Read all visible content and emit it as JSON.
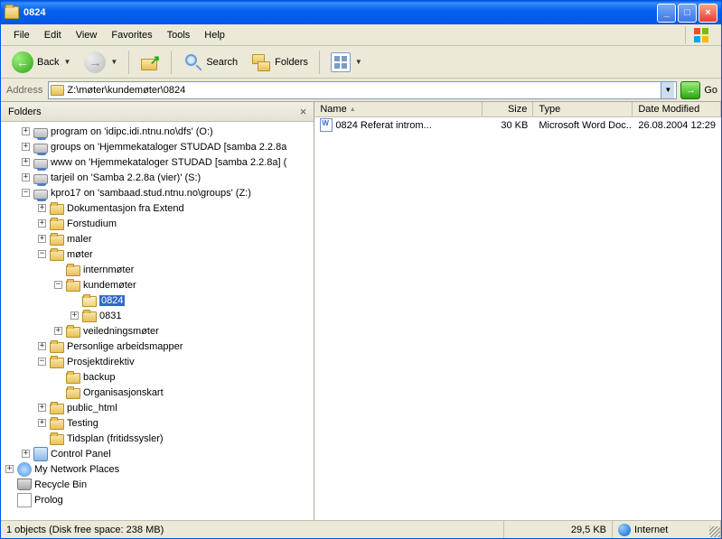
{
  "title": "0824",
  "menus": {
    "file": "File",
    "edit": "Edit",
    "view": "View",
    "favorites": "Favorites",
    "tools": "Tools",
    "help": "Help"
  },
  "toolbar": {
    "back": "Back",
    "search": "Search",
    "folders": "Folders"
  },
  "address": {
    "label": "Address",
    "value": "Z:\\møter\\kundemøter\\0824",
    "go": "Go"
  },
  "folders_pane": {
    "title": "Folders"
  },
  "tree": {
    "program": "program on 'idipc.idi.ntnu.no\\dfs' (O:)",
    "groups": "groups on 'Hjemmekataloger STUDAD [samba 2.2.8a",
    "www": "www on 'Hjemmekataloger STUDAD [samba 2.2.8a] (",
    "tarjeil": "tarjeil on 'Samba 2.2.8a (vier)' (S:)",
    "kpro17": "kpro17 on 'sambaad.stud.ntnu.no\\groups' (Z:)",
    "dokumentasjon": "Dokumentasjon fra Extend",
    "forstudium": "Forstudium",
    "maler": "maler",
    "moter": "møter",
    "internmoter": "internmøter",
    "kundemoter": "kundemøter",
    "d0824": "0824",
    "d0831": "0831",
    "veiledningsmoter": "veiledningsmøter",
    "personlige": "Personlige arbeidsmapper",
    "prosjektdirektiv": "Prosjektdirektiv",
    "backup": "backup",
    "organisasjonskart": "Organisasjonskart",
    "public_html": "public_html",
    "testing": "Testing",
    "tidsplan": "Tidsplan (fritidssysler)",
    "controlpanel": "Control Panel",
    "mynetwork": "My Network Places",
    "recyclebin": "Recycle Bin",
    "prolog": "Prolog"
  },
  "columns": {
    "name": "Name",
    "size": "Size",
    "type": "Type",
    "date": "Date Modified"
  },
  "file": {
    "name": "0824 Referat introm...",
    "size": "30 KB",
    "type": "Microsoft Word Doc...",
    "date": "26.08.2004 12:29"
  },
  "status": {
    "objects": "1 objects (Disk free space: 238 MB)",
    "size": "29,5 KB",
    "zone": "Internet"
  }
}
